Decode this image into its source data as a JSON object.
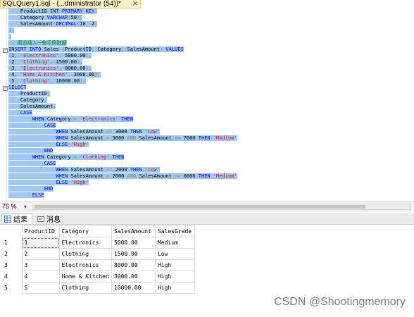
{
  "tab": {
    "title": "SQLQuery1.sql - (...dministrator (54))*",
    "close": "×"
  },
  "code": [
    {
      "indent": 4,
      "parts": [
        [
          "t",
          "ProductID "
        ],
        [
          "kw",
          "INT PRIMARY KEY"
        ],
        [
          "gray",
          ","
        ]
      ]
    },
    {
      "indent": 4,
      "parts": [
        [
          "t",
          "Category "
        ],
        [
          "kw",
          "VARCHAR"
        ],
        [
          "gray",
          "("
        ],
        [
          "t",
          "50"
        ],
        [
          "gray",
          "),"
        ]
      ]
    },
    {
      "indent": 4,
      "parts": [
        [
          "t",
          "SalesAmount "
        ],
        [
          "kw",
          "DECIMAL"
        ],
        [
          "gray",
          "("
        ],
        [
          "t",
          "10"
        ],
        [
          "gray",
          ", "
        ],
        [
          "t",
          "2"
        ],
        [
          "gray",
          ")"
        ]
      ]
    },
    {
      "indent": 0,
      "parts": [
        [
          "gray",
          ");"
        ]
      ]
    },
    {
      "indent": 0,
      "parts": [
        [
          "t",
          " "
        ]
      ]
    },
    {
      "indent": 0,
      "parts": [
        [
          "cmt",
          "-- 假设插入一些示例数据"
        ]
      ]
    },
    {
      "indent": 0,
      "parts": [
        [
          "kw",
          "INSERT INTO "
        ],
        [
          "t",
          "Sales "
        ],
        [
          "gray",
          "("
        ],
        [
          "t",
          "ProductID"
        ],
        [
          "gray",
          ", "
        ],
        [
          "t",
          "Category"
        ],
        [
          "gray",
          ", "
        ],
        [
          "t",
          "SalesAmount"
        ],
        [
          "gray",
          ") "
        ],
        [
          "kw",
          "VALUES"
        ]
      ]
    },
    {
      "indent": 0,
      "parts": [
        [
          "gray",
          "("
        ],
        [
          "t",
          "1"
        ],
        [
          "gray",
          ", "
        ],
        [
          "str",
          "'Electronics'"
        ],
        [
          "gray",
          ", "
        ],
        [
          "t",
          "5000.00"
        ],
        [
          "gray",
          "),"
        ]
      ]
    },
    {
      "indent": 0,
      "parts": [
        [
          "gray",
          "("
        ],
        [
          "t",
          "2"
        ],
        [
          "gray",
          ", "
        ],
        [
          "str",
          "'Clothing'"
        ],
        [
          "gray",
          ", "
        ],
        [
          "t",
          "1500.00"
        ],
        [
          "gray",
          "),"
        ]
      ]
    },
    {
      "indent": 0,
      "parts": [
        [
          "gray",
          "("
        ],
        [
          "t",
          "3"
        ],
        [
          "gray",
          ", "
        ],
        [
          "str",
          "'Electronics'"
        ],
        [
          "gray",
          ", "
        ],
        [
          "t",
          "8000.00"
        ],
        [
          "gray",
          "),"
        ]
      ]
    },
    {
      "indent": 0,
      "parts": [
        [
          "gray",
          "("
        ],
        [
          "t",
          "4"
        ],
        [
          "gray",
          ", "
        ],
        [
          "str",
          "'Home & Kitchen'"
        ],
        [
          "gray",
          ", "
        ],
        [
          "t",
          "3000.00"
        ],
        [
          "gray",
          "),"
        ]
      ]
    },
    {
      "indent": 0,
      "parts": [
        [
          "gray",
          "("
        ],
        [
          "t",
          "5"
        ],
        [
          "gray",
          ", "
        ],
        [
          "str",
          "'Clothing'"
        ],
        [
          "gray",
          ", "
        ],
        [
          "t",
          "10000.00"
        ],
        [
          "gray",
          ");"
        ]
      ]
    },
    {
      "indent": 0,
      "parts": [
        [
          "kw",
          "SELECT"
        ]
      ]
    },
    {
      "indent": 4,
      "parts": [
        [
          "t",
          "ProductID"
        ],
        [
          "gray",
          ","
        ]
      ]
    },
    {
      "indent": 4,
      "parts": [
        [
          "t",
          "Category"
        ],
        [
          "gray",
          ","
        ]
      ]
    },
    {
      "indent": 4,
      "parts": [
        [
          "t",
          "SalesAmount"
        ],
        [
          "gray",
          ","
        ]
      ]
    },
    {
      "indent": 4,
      "parts": [
        [
          "kw",
          "CASE"
        ]
      ]
    },
    {
      "indent": 8,
      "parts": [
        [
          "kw",
          "WHEN "
        ],
        [
          "t",
          "Category "
        ],
        [
          "gray",
          "= "
        ],
        [
          "str",
          "'Electronics'"
        ],
        [
          "kw",
          " THEN"
        ]
      ]
    },
    {
      "indent": 12,
      "parts": [
        [
          "kw",
          "CASE"
        ]
      ]
    },
    {
      "indent": 16,
      "parts": [
        [
          "kw",
          "WHEN "
        ],
        [
          "t",
          "SalesAmount "
        ],
        [
          "gray",
          "<= "
        ],
        [
          "t",
          "3000 "
        ],
        [
          "kw",
          "THEN "
        ],
        [
          "str",
          "'Low'"
        ]
      ]
    },
    {
      "indent": 16,
      "parts": [
        [
          "kw",
          "WHEN "
        ],
        [
          "t",
          "SalesAmount "
        ],
        [
          "gray",
          "> "
        ],
        [
          "t",
          "3000 "
        ],
        [
          "gray",
          "AND "
        ],
        [
          "t",
          "SalesAmount "
        ],
        [
          "gray",
          "<= "
        ],
        [
          "t",
          "7000 "
        ],
        [
          "kw",
          "THEN "
        ],
        [
          "str",
          "'Medium'"
        ]
      ]
    },
    {
      "indent": 16,
      "parts": [
        [
          "kw",
          "ELSE "
        ],
        [
          "str",
          "'High'"
        ]
      ]
    },
    {
      "indent": 12,
      "parts": [
        [
          "kw",
          "END"
        ]
      ]
    },
    {
      "indent": 8,
      "parts": [
        [
          "kw",
          "WHEN "
        ],
        [
          "t",
          "Category "
        ],
        [
          "gray",
          "= "
        ],
        [
          "str",
          "'Clothing'"
        ],
        [
          "kw",
          " THEN"
        ]
      ]
    },
    {
      "indent": 12,
      "parts": [
        [
          "kw",
          "CASE"
        ]
      ]
    },
    {
      "indent": 16,
      "parts": [
        [
          "kw",
          "WHEN "
        ],
        [
          "t",
          "SalesAmount "
        ],
        [
          "gray",
          "<= "
        ],
        [
          "t",
          "2000 "
        ],
        [
          "kw",
          "THEN "
        ],
        [
          "str",
          "'Low'"
        ]
      ]
    },
    {
      "indent": 16,
      "parts": [
        [
          "kw",
          "WHEN "
        ],
        [
          "t",
          "SalesAmount "
        ],
        [
          "gray",
          "> "
        ],
        [
          "t",
          "2000 "
        ],
        [
          "gray",
          "AND "
        ],
        [
          "t",
          "SalesAmount "
        ],
        [
          "gray",
          "<= "
        ],
        [
          "t",
          "6000 "
        ],
        [
          "kw",
          "THEN "
        ],
        [
          "str",
          "'Medium'"
        ]
      ]
    },
    {
      "indent": 16,
      "parts": [
        [
          "kw",
          "ELSE "
        ],
        [
          "str",
          "'High'"
        ]
      ]
    },
    {
      "indent": 12,
      "parts": [
        [
          "kw",
          "END"
        ]
      ]
    },
    {
      "indent": 8,
      "parts": [
        [
          "kw",
          "ELSE"
        ]
      ]
    }
  ],
  "zoom": {
    "label": "75 %",
    "caret": "▾"
  },
  "results_tabs": {
    "results": "结果",
    "messages": "消息"
  },
  "grid": {
    "columns": [
      "ProductID",
      "Category",
      "SalesAmount",
      "SalesGrade"
    ],
    "rows": [
      {
        "num": "1",
        "cells": [
          "1",
          "Electronics",
          "5000.00",
          "Medium"
        ]
      },
      {
        "num": "2",
        "cells": [
          "2",
          "Clothing",
          "1500.00",
          "Low"
        ]
      },
      {
        "num": "3",
        "cells": [
          "3",
          "Electronics",
          "8000.00",
          "High"
        ]
      },
      {
        "num": "4",
        "cells": [
          "4",
          "Home & Kitchen",
          "3000.00",
          "High"
        ]
      },
      {
        "num": "5",
        "cells": [
          "5",
          "Clothing",
          "10000.00",
          "High"
        ]
      }
    ]
  },
  "watermark": "CSDN @Shootingmemory",
  "colors": {
    "selection": "#9fc7ef",
    "keyword": "#0000ff",
    "string": "#c8102e",
    "comment": "#008000",
    "tab_active": "#fff1c7"
  }
}
